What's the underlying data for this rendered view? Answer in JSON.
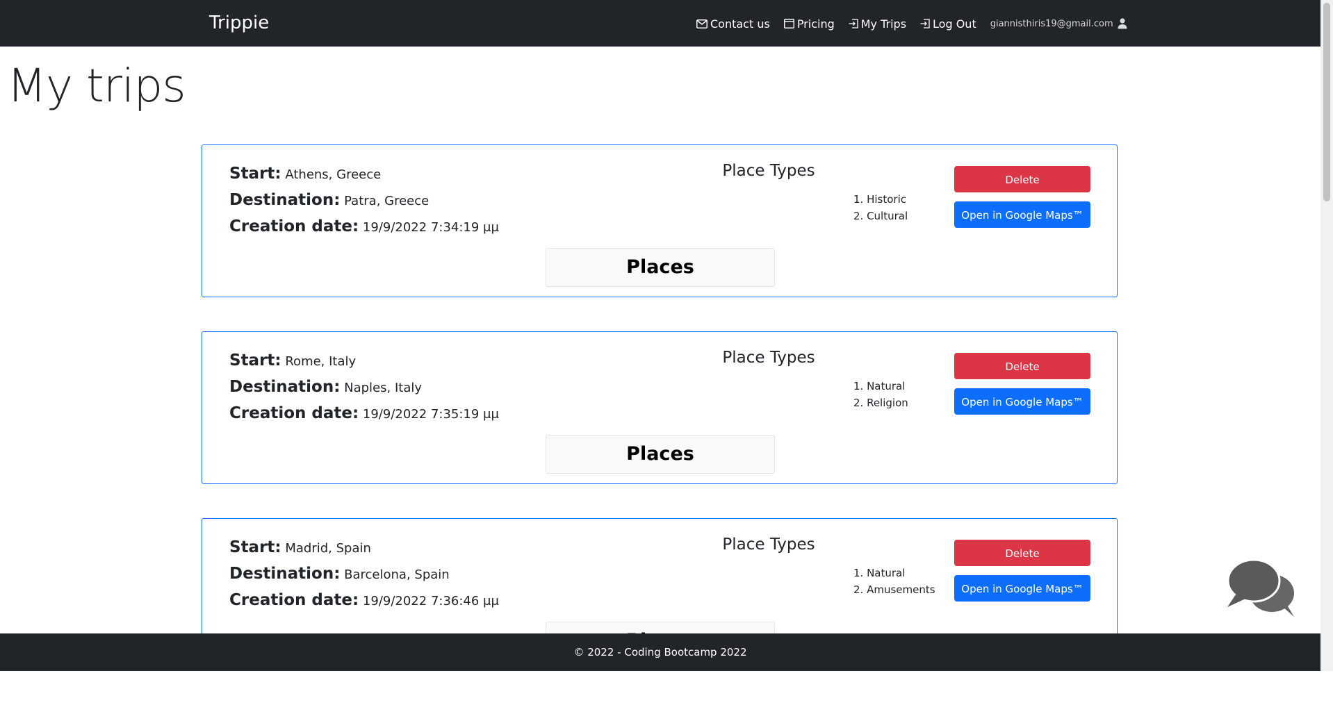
{
  "navbar": {
    "brand": "Trippie",
    "links": [
      {
        "label": "Contact us",
        "icon": "envelope-icon"
      },
      {
        "label": "Pricing",
        "icon": "window-icon"
      },
      {
        "label": "My Trips",
        "icon": "box-arrow-in-icon"
      },
      {
        "label": "Log Out",
        "icon": "box-arrow-in-icon"
      }
    ],
    "email": "giannisthiris19@gmail.com"
  },
  "page_title": "My trips",
  "labels": {
    "start": "Start:",
    "destination": "Destination:",
    "creation_date": "Creation date:",
    "place_types": "Place Types",
    "delete": "Delete",
    "open_maps": "Open in Google Maps™",
    "places": "Places"
  },
  "trips": [
    {
      "start": "Athens, Greece",
      "destination": "Patra, Greece",
      "creation_date": "19/9/2022 7:34:19 μμ",
      "place_types": [
        "1. Historic",
        "2. Cultural"
      ]
    },
    {
      "start": "Rome, Italy",
      "destination": "Naples, Italy",
      "creation_date": "19/9/2022 7:35:19 μμ",
      "place_types": [
        "1. Natural",
        "2. Religion"
      ]
    },
    {
      "start": "Madrid, Spain",
      "destination": "Barcelona, Spain",
      "creation_date": "19/9/2022 7:36:46 μμ",
      "place_types": [
        "1. Natural",
        "2. Amusements"
      ]
    }
  ],
  "footer": {
    "text": "© 2022 - Coding Bootcamp 2022"
  },
  "colors": {
    "navbar_bg": "#212529",
    "card_border": "#0d6efd",
    "danger": "#dc3545",
    "primary": "#0d6efd"
  }
}
